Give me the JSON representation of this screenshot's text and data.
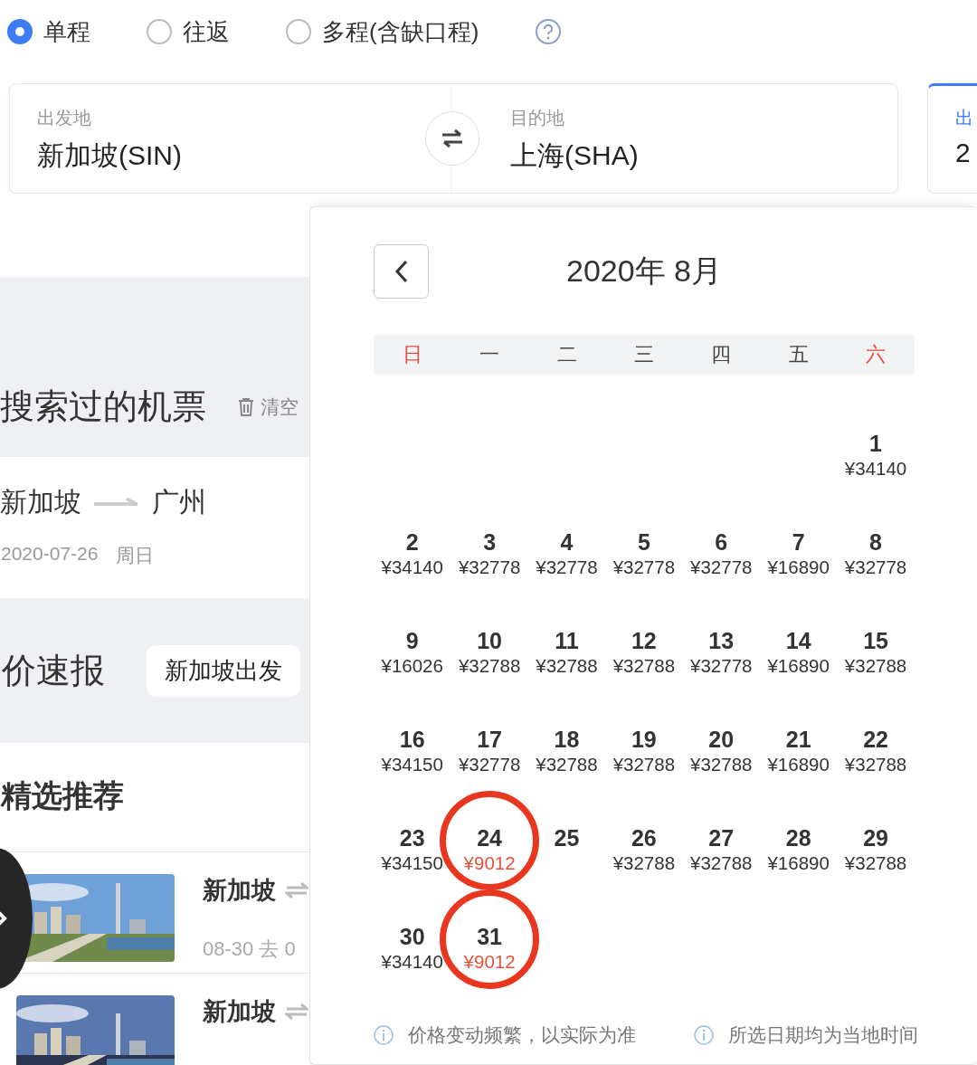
{
  "trip_types": [
    {
      "label": "单程",
      "selected": true
    },
    {
      "label": "往返",
      "selected": false
    },
    {
      "label": "多程(含缺口程)",
      "selected": false
    }
  ],
  "route": {
    "origin": {
      "label": "出发地",
      "value": "新加坡(SIN)"
    },
    "destination": {
      "label": "目的地",
      "value": "上海(SHA)"
    },
    "next_card": {
      "label": "出",
      "value": "2"
    }
  },
  "history": {
    "title": "搜索过的机票",
    "clear": "清空",
    "items": [
      {
        "from": "新加坡",
        "to": "广州",
        "date": "2020-07-26",
        "weekday": "周日"
      }
    ]
  },
  "deals": {
    "title": "价速报",
    "filter": "新加坡出发"
  },
  "featured": {
    "title": "精选推荐",
    "items": [
      {
        "kind": "picture",
        "city": "新加坡",
        "dates": "08-30 去 0"
      },
      {
        "kind": "picture",
        "city": "新加坡"
      }
    ]
  },
  "calendar": {
    "title": "2020年 8月",
    "weekdays": [
      {
        "label": "日",
        "weekend": true
      },
      {
        "label": "一",
        "weekend": false
      },
      {
        "label": "二",
        "weekend": false
      },
      {
        "label": "三",
        "weekend": false
      },
      {
        "label": "四",
        "weekend": false
      },
      {
        "label": "五",
        "weekend": false
      },
      {
        "label": "六",
        "weekend": true
      }
    ],
    "weeks": [
      [
        {
          "day": "1",
          "price": "¥34140",
          "lowest": false,
          "circled": false
        }
      ],
      [
        {
          "day": "2",
          "price": "¥34140",
          "lowest": false,
          "circled": false
        },
        {
          "day": "3",
          "price": "¥32778",
          "lowest": false,
          "circled": false
        },
        {
          "day": "4",
          "price": "¥32778",
          "lowest": false,
          "circled": false
        },
        {
          "day": "5",
          "price": "¥32778",
          "lowest": false,
          "circled": false
        },
        {
          "day": "6",
          "price": "¥32778",
          "lowest": false,
          "circled": false
        },
        {
          "day": "7",
          "price": "¥16890",
          "lowest": false,
          "circled": false
        },
        {
          "day": "8",
          "price": "¥32778",
          "lowest": false,
          "circled": false
        }
      ],
      [
        {
          "day": "9",
          "price": "¥16026",
          "lowest": false,
          "circled": false
        },
        {
          "day": "10",
          "price": "¥32788",
          "lowest": false,
          "circled": false
        },
        {
          "day": "11",
          "price": "¥32788",
          "lowest": false,
          "circled": false
        },
        {
          "day": "12",
          "price": "¥32788",
          "lowest": false,
          "circled": false
        },
        {
          "day": "13",
          "price": "¥32778",
          "lowest": false,
          "circled": false
        },
        {
          "day": "14",
          "price": "¥16890",
          "lowest": false,
          "circled": false
        },
        {
          "day": "15",
          "price": "¥32788",
          "lowest": false,
          "circled": false
        }
      ],
      [
        {
          "day": "16",
          "price": "¥34150",
          "lowest": false,
          "circled": false
        },
        {
          "day": "17",
          "price": "¥32778",
          "lowest": false,
          "circled": false
        },
        {
          "day": "18",
          "price": "¥32788",
          "lowest": false,
          "circled": false
        },
        {
          "day": "19",
          "price": "¥32788",
          "lowest": false,
          "circled": false
        },
        {
          "day": "20",
          "price": "¥32788",
          "lowest": false,
          "circled": false
        },
        {
          "day": "21",
          "price": "¥16890",
          "lowest": false,
          "circled": false
        },
        {
          "day": "22",
          "price": "¥32788",
          "lowest": false,
          "circled": false
        }
      ],
      [
        {
          "day": "23",
          "price": "¥34150",
          "lowest": false,
          "circled": false
        },
        {
          "day": "24",
          "price": "¥9012",
          "lowest": true,
          "circled": true
        },
        {
          "day": "25"
        },
        {
          "day": "26",
          "price": "¥32788",
          "lowest": false,
          "circled": false
        },
        {
          "day": "27",
          "price": "¥32788",
          "lowest": false,
          "circled": false
        },
        {
          "day": "28",
          "price": "¥16890",
          "lowest": false,
          "circled": false
        },
        {
          "day": "29",
          "price": "¥32788",
          "lowest": false,
          "circled": false
        }
      ],
      [
        {
          "day": "30",
          "price": "¥34140",
          "lowest": false,
          "circled": false
        },
        {
          "day": "31",
          "price": "¥9012",
          "lowest": true,
          "circled": true
        }
      ]
    ],
    "notes": [
      "价格变动频繁，以实际为准",
      "所选日期均为当地时间"
    ]
  }
}
